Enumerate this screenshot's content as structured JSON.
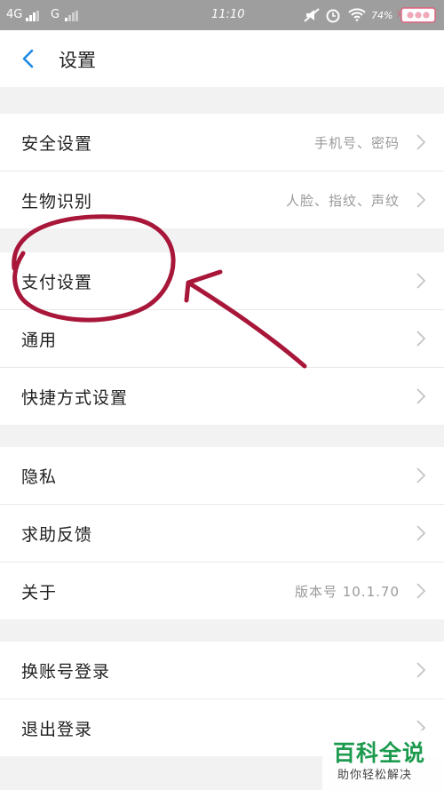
{
  "status_bar": {
    "network1": "4G",
    "network2": "G",
    "time": "11:10",
    "battery": "74%"
  },
  "header": {
    "title": "设置"
  },
  "groups": [
    {
      "items": [
        {
          "label": "安全设置",
          "value": "手机号、密码"
        },
        {
          "label": "生物识别",
          "value": "人脸、指纹、声纹"
        }
      ]
    },
    {
      "items": [
        {
          "label": "支付设置",
          "value": ""
        },
        {
          "label": "通用",
          "value": ""
        },
        {
          "label": "快捷方式设置",
          "value": ""
        }
      ]
    },
    {
      "items": [
        {
          "label": "隐私",
          "value": ""
        },
        {
          "label": "求助反馈",
          "value": ""
        },
        {
          "label": "关于",
          "value": "版本号 10.1.70"
        }
      ]
    },
    {
      "items": [
        {
          "label": "换账号登录",
          "value": ""
        },
        {
          "label": "退出登录",
          "value": ""
        }
      ]
    }
  ],
  "watermark": {
    "title": "百科全说",
    "subtitle": "助你轻松解决"
  },
  "colors": {
    "accent": "#1e88e5",
    "annotation": "#a8173a",
    "watermark": "#1c9a4e"
  }
}
